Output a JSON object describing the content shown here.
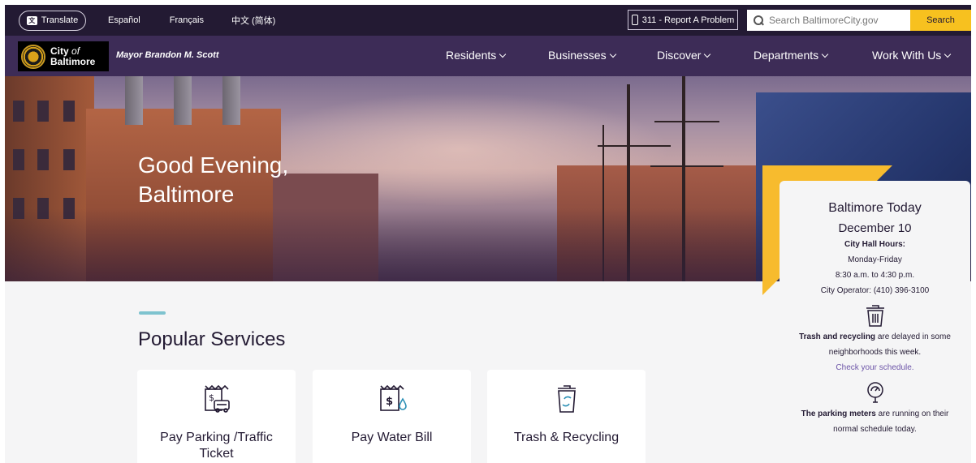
{
  "utility": {
    "translate_label": "Translate",
    "languages": [
      "Español",
      "Français",
      "中文 (简体)"
    ],
    "report_label": "311 - Report A Problem",
    "search_placeholder": "Search BaltimoreCity.gov",
    "search_button": "Search"
  },
  "nav": {
    "logo_line1": "City",
    "logo_of": "of",
    "logo_line2": "Baltimore",
    "mayor": "Mayor Brandon M. Scott",
    "items": [
      "Residents",
      "Businesses",
      "Discover",
      "Departments",
      "Work With Us"
    ]
  },
  "hero": {
    "greeting_line1": "Good Evening,",
    "greeting_line2": "Baltimore"
  },
  "services": {
    "title": "Popular Services",
    "cards": [
      {
        "label": "Pay Parking /Traffic Ticket",
        "icon": "parking-ticket-icon"
      },
      {
        "label": "Pay Water Bill",
        "icon": "water-bill-icon"
      },
      {
        "label": "Trash & Recycling",
        "icon": "trash-recycling-icon"
      }
    ]
  },
  "today": {
    "title": "Baltimore Today",
    "date": "December 10",
    "hours_label": "City Hall Hours:",
    "hours_days": "Monday-Friday",
    "hours_time": "8:30 a.m. to 4:30 p.m.",
    "operator": "City Operator: (410) 396-3100",
    "trash_bold": "Trash and recycling",
    "trash_rest": " are delayed in some",
    "trash_line2": "neighborhoods this week.",
    "trash_link": "Check your schedule.",
    "meters_bold": "The parking meters",
    "meters_rest": " are running on their",
    "meters_line2": "normal schedule today."
  },
  "colors": {
    "utility_bg": "#231a33",
    "nav_bg": "#3d2c57",
    "accent_yellow": "#f7c11f",
    "accent_teal": "#7ec3cf",
    "link_purple": "#6d55a8"
  }
}
